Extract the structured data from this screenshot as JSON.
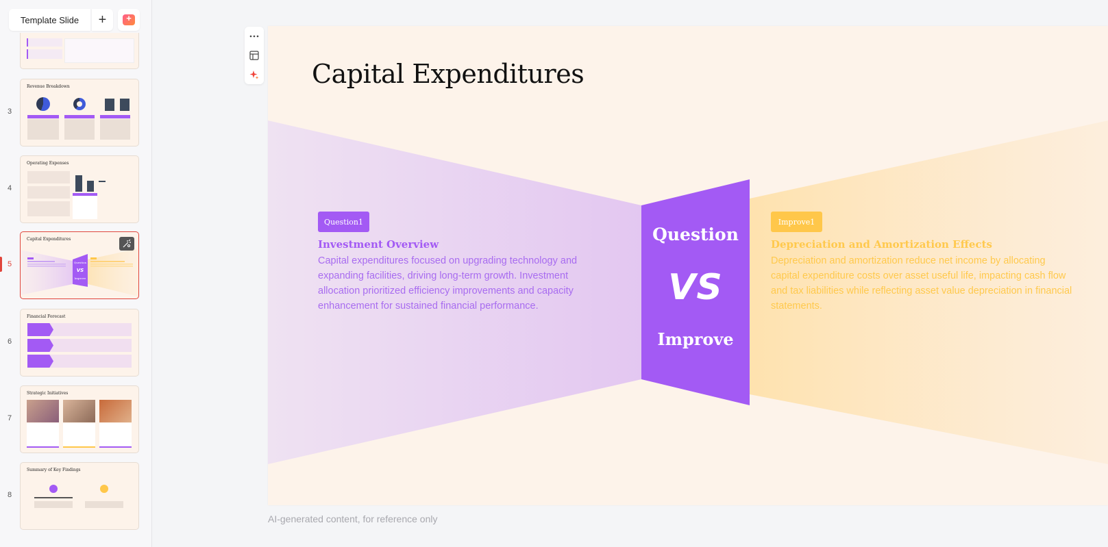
{
  "sidebar": {
    "template_label": "Template Slide",
    "add_label": "+",
    "thumbs": [
      {
        "num": "3",
        "title": "Revenue Breakdown"
      },
      {
        "num": "4",
        "title": "Operating Expenses"
      },
      {
        "num": "5",
        "title": "Capital Expenditures"
      },
      {
        "num": "6",
        "title": "Financial Forecast"
      },
      {
        "num": "7",
        "title": "Strategic Initiatives"
      },
      {
        "num": "8",
        "title": "Summary of Key Findings"
      }
    ],
    "active_num": "5"
  },
  "tools": {
    "more_icon": "more-icon",
    "layout_icon": "layout-icon",
    "ai_icon": "sparkle-icon"
  },
  "slide": {
    "title": "Capital Expenditures",
    "left": {
      "badge": "Question1",
      "heading": "Investment Overview",
      "body": "Capital expenditures focused on upgrading technology and expanding facilities, driving long-term growth. Investment allocation prioritized efficiency improvements and capacity enhancement for sustained financial performance."
    },
    "center": {
      "top": "Question",
      "vs": "VS",
      "bottom": "Improve"
    },
    "right": {
      "badge": "Improve1",
      "heading": "Depreciation and Amortization Effects",
      "body": "Depreciation and amortization reduce net income by allocating capital expenditure costs over asset useful life, impacting cash flow and tax liabilities while reflecting asset value depreciation in financial statements."
    }
  },
  "footnote": "AI-generated content, for reference only",
  "colors": {
    "purple": "#a35af4",
    "yellow": "#ffc74a",
    "accent_red": "#e0453b",
    "slide_bg": "#fdf3ea"
  }
}
